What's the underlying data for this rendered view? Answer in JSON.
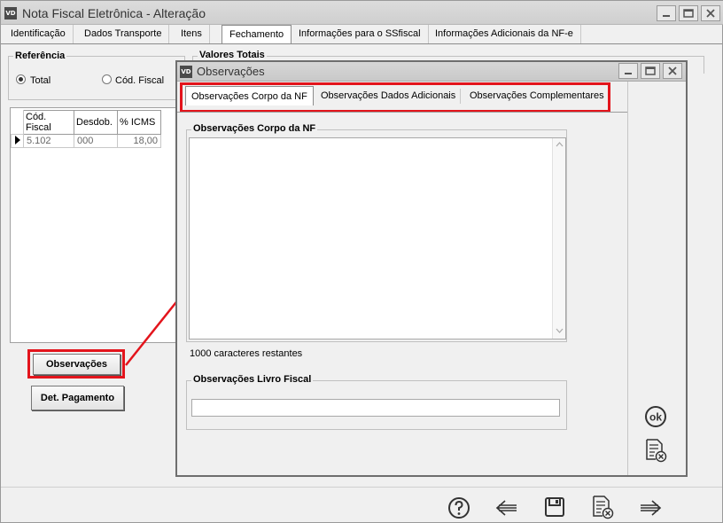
{
  "window": {
    "logo": "VD",
    "title": "Nota Fiscal Eletrônica - Alteração"
  },
  "tabs": [
    "Identificação",
    "Dados Transporte",
    "Itens",
    "Fechamento",
    "Informações para o SSfiscal",
    "Informações Adicionais da NF-e"
  ],
  "referencia": {
    "title": "Referência",
    "options": [
      "Total",
      "Cód. Fiscal"
    ],
    "selected": "Total"
  },
  "valores_totais": {
    "title": "Valores Totais"
  },
  "grid": {
    "headers": [
      "Cód. Fiscal",
      "Desdob.",
      "% ICMS"
    ],
    "rows": [
      [
        "5.102",
        "000",
        "18,00"
      ]
    ]
  },
  "buttons": {
    "observacoes": "Observações",
    "det_pagamento": "Det. Pagamento"
  },
  "dialog": {
    "logo": "VD",
    "title": "Observações",
    "tabs": [
      "Observações Corpo da NF",
      "Observações Dados Adicionais",
      "Observações Complementares"
    ],
    "active_tab": "Observações Corpo da NF",
    "corpo": {
      "title": "Observações Corpo da NF",
      "value": "",
      "remaining": "1000 caracteres restantes"
    },
    "livro": {
      "title": "Observações Livro Fiscal",
      "value": ""
    },
    "ok_label": "ok"
  },
  "accent": {
    "highlight": "#e3141c"
  }
}
